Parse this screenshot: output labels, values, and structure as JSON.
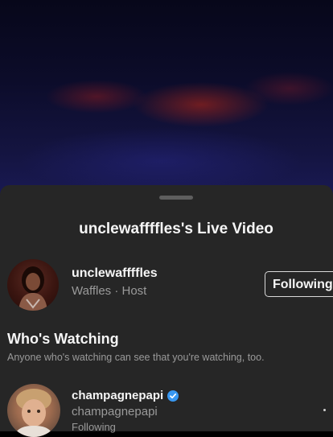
{
  "live": {
    "title": "unclewaffffles's Live Video"
  },
  "host": {
    "username": "unclewaffffles",
    "subtitle": "Waffles · Host",
    "follow_label": "Following"
  },
  "watching": {
    "heading": "Who's Watching",
    "description": "Anyone who's watching can see that you're watching, too.",
    "viewers": [
      {
        "username": "champagnepapi",
        "handle": "champagnepapi",
        "status": "Following",
        "verified": true
      }
    ]
  },
  "colors": {
    "sheet_background": "#262626",
    "verified_badge": "#3897f0",
    "primary_text": "#f5f5f5",
    "secondary_text": "#9a9a9a"
  }
}
